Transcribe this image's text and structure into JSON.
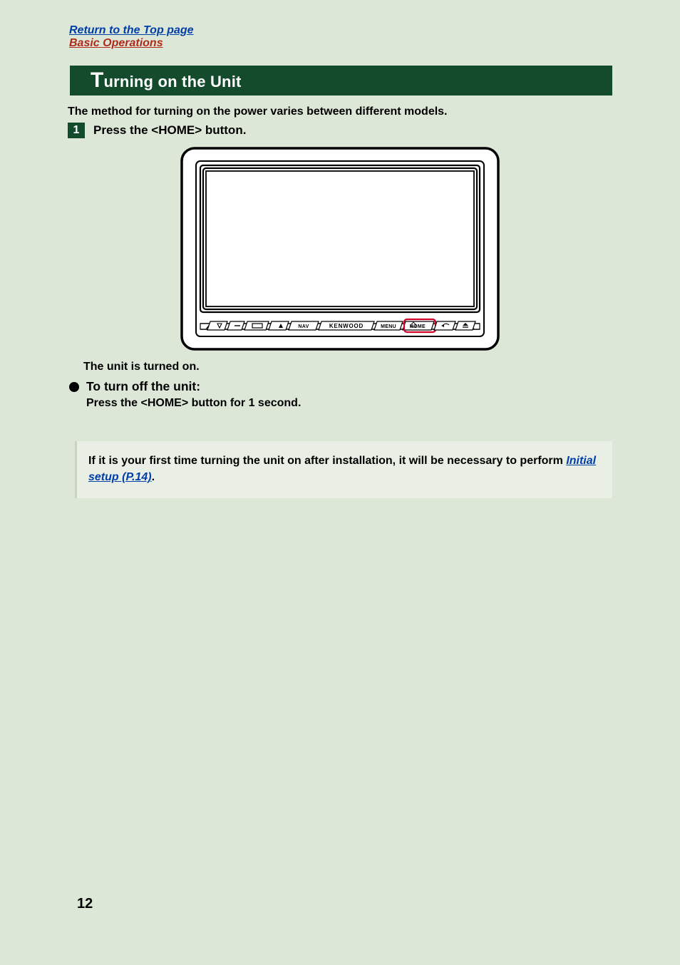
{
  "nav": {
    "top_link": "Return to the Top page",
    "section_link": "Basic Operations"
  },
  "title": {
    "dropcap": "T",
    "rest": "urning on the Unit"
  },
  "intro": "The method for turning on the power varies between different models.",
  "step": {
    "number": "1",
    "text": "Press the <HOME> button."
  },
  "device": {
    "brand": "KENWOOD",
    "buttons": {
      "nav": "NAV",
      "menu": "MENU",
      "home": "HOME"
    }
  },
  "result": "The unit is turned on.",
  "turn_off": {
    "heading": "To turn off the unit:",
    "body": "Press the <HOME> button for 1 second."
  },
  "note": {
    "lead": "If it is your first time turning the unit on after installation, it will be necessary to perform ",
    "link": "Initial setup (P.14)",
    "tail": "."
  },
  "page_number": "12"
}
